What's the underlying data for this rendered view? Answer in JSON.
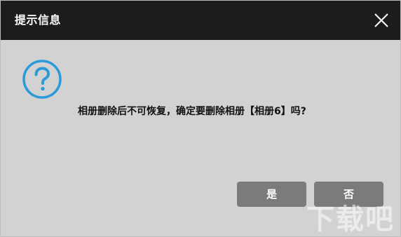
{
  "dialog": {
    "title": "提示信息",
    "message": "相册删除后不可恢复，确定要删除相册【相册6】吗?",
    "icons": {
      "close": "close-icon",
      "help": "question-mark-icon"
    },
    "buttons": {
      "yes_label": "是",
      "no_label": "否"
    }
  },
  "watermark": {
    "text": "下载吧"
  },
  "colors": {
    "titlebar_bg": "#1c1c1c",
    "body_bg": "#d2d2d2",
    "button_bg": "#7b7b7b",
    "help_icon": "#2b9ad9"
  }
}
